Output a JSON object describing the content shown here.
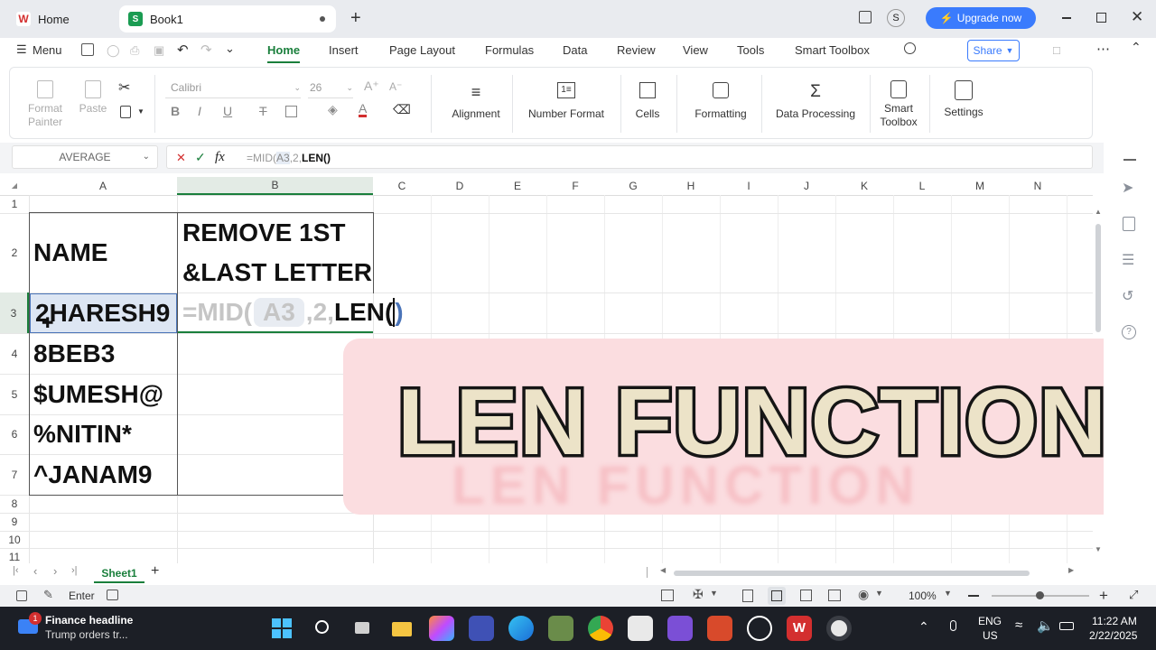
{
  "tabs": {
    "home": "Home",
    "book": "Book1",
    "upgrade": "Upgrade now"
  },
  "menu": {
    "menu_label": "Menu",
    "items": [
      "Home",
      "Insert",
      "Page Layout",
      "Formulas",
      "Data",
      "Review",
      "View",
      "Tools",
      "Smart Toolbox"
    ],
    "share": "Share"
  },
  "ribbon": {
    "format_painter": "Format Painter",
    "paste": "Paste",
    "font_name": "Calibri",
    "font_size": "26",
    "alignment": "Alignment",
    "number_format": "Number Format",
    "cells": "Cells",
    "formatting": "Formatting",
    "data_processing": "Data Processing",
    "smart_toolbox": "Smart Toolbox",
    "settings": "Settings"
  },
  "formula_bar": {
    "name_box": "AVERAGE",
    "fx": "fx",
    "formula_prefix": "=MID(",
    "formula_ref": "A3",
    "formula_mid": ",2,",
    "formula_end": "LEN()"
  },
  "columns": [
    "A",
    "B",
    "C",
    "D",
    "E",
    "F",
    "G",
    "H",
    "I",
    "J",
    "K",
    "L",
    "M",
    "N"
  ],
  "rows": [
    "1",
    "2",
    "3",
    "4",
    "5",
    "6",
    "7",
    "8",
    "9",
    "10",
    "11"
  ],
  "cells": {
    "a2": "NAME",
    "b2_line1": "REMOVE 1ST",
    "b2_line2": "&LAST LETTER",
    "a3": "2HARESH9",
    "a4": "8BEB3",
    "a5": "$UMESH@",
    "a6": "%NITIN*",
    "a7": "^JANAM9",
    "b3_prefix": "=MID(",
    "b3_ref": "A3",
    "b3_mid": ",2,",
    "b3_end": "LEN(",
    "b3_paren": ")"
  },
  "overlay_text": "LEN FUNCTION",
  "sheet": {
    "name": "Sheet1"
  },
  "status": {
    "mode": "Enter",
    "zoom": "100%"
  },
  "taskbar": {
    "news_title": "Finance headline",
    "news_sub": "Trump orders tr...",
    "lang": "ENG",
    "region": "US",
    "time": "11:22 AM",
    "date": "2/22/2025",
    "badge": "1"
  },
  "colors": {
    "accent": "#1a7f3c",
    "wps_red": "#d32f2f",
    "upgrade_blue": "#3a7bfd",
    "overlay": "#fbdde0"
  }
}
